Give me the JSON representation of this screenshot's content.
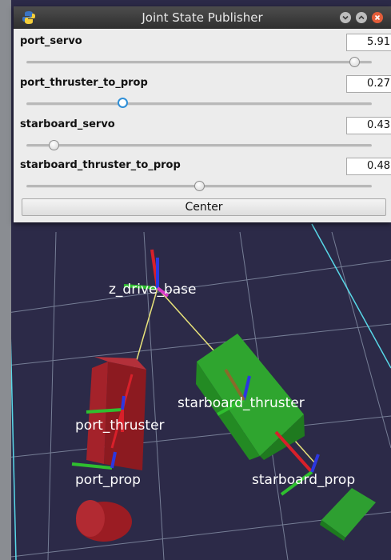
{
  "window": {
    "title": "Joint State Publisher"
  },
  "joints": [
    {
      "name": "port_servo",
      "value": "5.91",
      "fraction": 0.95
    },
    {
      "name": "port_thruster_to_prop",
      "value": "0.27",
      "fraction": 0.28
    },
    {
      "name": "starboard_servo",
      "value": "0.43",
      "fraction": 0.08
    },
    {
      "name": "starboard_thruster_to_prop",
      "value": "0.48",
      "fraction": 0.5
    }
  ],
  "center_button": "Center",
  "scene": {
    "labels": {
      "z_drive_base": "z_drive_base",
      "starboard_thruster": "starboard_thruster",
      "port_thruster": "port_thruster",
      "port_prop": "port_prop",
      "starboard_prop": "starboard_prop"
    },
    "colors": {
      "background": "#2c2a48",
      "grid": "#8f9ab0",
      "grid_axis": "#58d8e8",
      "port_links": "#9e1b22",
      "starboard_links": "#2fa52f"
    }
  }
}
